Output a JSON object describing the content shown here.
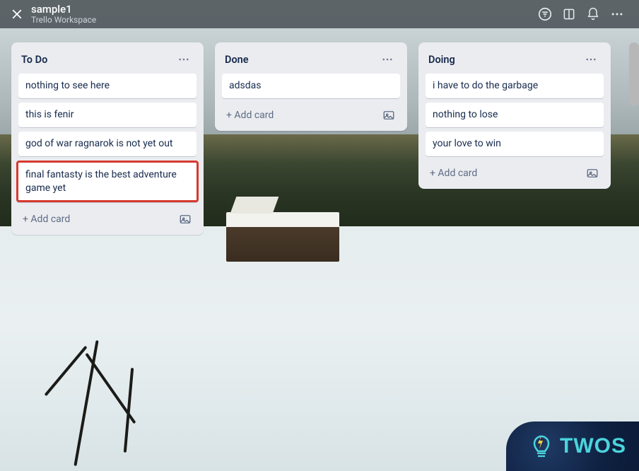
{
  "header": {
    "board_title": "sample1",
    "workspace": "Trello Workspace"
  },
  "lists": [
    {
      "title": "To Do",
      "cards": [
        {
          "text": "nothing to see here",
          "highlight": false
        },
        {
          "text": "this is fenir",
          "highlight": false
        },
        {
          "text": "god of war ragnarok is not yet out",
          "highlight": false
        },
        {
          "text": "final fantasty is the best adventure game yet",
          "highlight": true
        }
      ]
    },
    {
      "title": "Done",
      "cards": [
        {
          "text": "adsdas",
          "highlight": false
        }
      ]
    },
    {
      "title": "Doing",
      "cards": [
        {
          "text": "i have to do the garbage",
          "highlight": false
        },
        {
          "text": "nothing to lose",
          "highlight": false
        },
        {
          "text": "your love to win",
          "highlight": false
        }
      ]
    }
  ],
  "labels": {
    "add_card": "+ Add card"
  },
  "watermark": {
    "text": "TWOS"
  }
}
